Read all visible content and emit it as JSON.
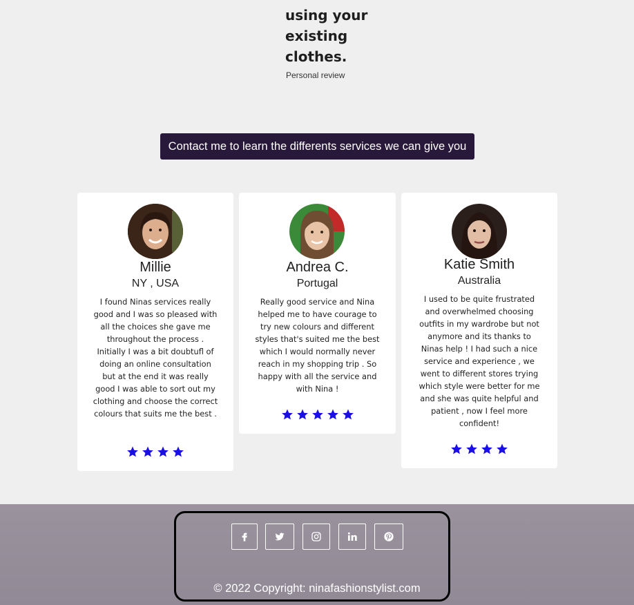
{
  "hero": {
    "heading_lines": [
      "using your",
      "existing",
      "clothes."
    ],
    "subtitle": "Personal review"
  },
  "contact_button": {
    "label": "Contact me to learn the differents services we can give you"
  },
  "testimonials": [
    {
      "name": "Millie",
      "location": "NY , USA",
      "text": "I found Ninas services really good and I was so pleased with all the choices she gave me throughout the process . Initially I was a bit doubtufl of doing an online consultation but at the end it was really good I was able to sort out my clothing and choose the correct colours that suits me the best .",
      "stars": 4
    },
    {
      "name": "Andrea C.",
      "location": "Portugal",
      "text": "Really good service and Nina helped me to have courage to try new colours and different styles that's suited me the best which I would normally never reach in my shopping trip . So happy with all the service and with Nina !",
      "stars": 5
    },
    {
      "name": "Katie Smith",
      "location": "Australia",
      "text": "I used to be quite frustrated and overwhelmed choosing outfits in my wardrobe but not anymore and its thanks to Ninas help ! I had such a nice service and experience , we went to different stores trying which style were better for me and she was quite helpful and patient , now I feel more confident!",
      "stars": 4
    }
  ],
  "footer": {
    "social": [
      {
        "icon": "facebook-icon"
      },
      {
        "icon": "twitter-icon"
      },
      {
        "icon": "instagram-icon"
      },
      {
        "icon": "linkedin-icon"
      },
      {
        "icon": "pinterest-icon"
      }
    ],
    "copyright": "© 2022 Copyright: ninafashionstylist.com"
  },
  "colors": {
    "button_bg": "#28183a",
    "star": "#1a0ee6",
    "footer_bg": "#9a939e"
  }
}
